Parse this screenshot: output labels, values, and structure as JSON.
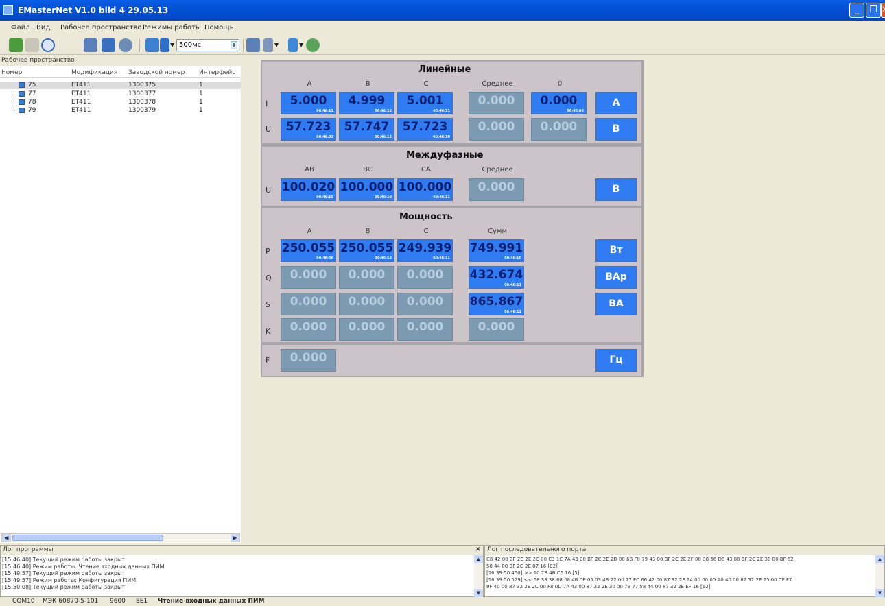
{
  "window": {
    "title": "EMasterNet  V1.0 bild 4 29.05.13"
  },
  "menu": [
    "Файл",
    "Вид",
    "Рабочее пространство",
    "Режимы работы",
    "Помощь"
  ],
  "toolbar": {
    "interval": "500мс"
  },
  "workspace": {
    "title": "Рабочее пространство",
    "columns": [
      "Номер",
      "Модификация",
      "Заводской номер",
      "Интерфейс"
    ],
    "rows": [
      {
        "num": "75",
        "mod": "ET411",
        "serial": "1300375",
        "iface": "1"
      },
      {
        "num": "77",
        "mod": "ET411",
        "serial": "1300377",
        "iface": "1"
      },
      {
        "num": "78",
        "mod": "ET411",
        "serial": "1300378",
        "iface": "1"
      },
      {
        "num": "79",
        "mod": "ET411",
        "serial": "1300379",
        "iface": "1"
      }
    ]
  },
  "linear": {
    "title": "Линейные",
    "cols": [
      "A",
      "B",
      "C",
      "Среднее",
      "0"
    ],
    "rows": [
      {
        "label": "I",
        "unit": "A",
        "cells": [
          {
            "v": "5.000",
            "ts": "00:46:11",
            "on": true
          },
          {
            "v": "4.999",
            "ts": "00:46:12",
            "on": true
          },
          {
            "v": "5.001",
            "ts": "00:46:11",
            "on": true
          },
          {
            "v": "0.000",
            "ts": "",
            "on": false
          },
          {
            "v": "0.000",
            "ts": "00:46:06",
            "on": true
          }
        ]
      },
      {
        "label": "U",
        "unit": "В",
        "cells": [
          {
            "v": "57.723",
            "ts": "00:46:02",
            "on": true
          },
          {
            "v": "57.747",
            "ts": "00:46:12",
            "on": true
          },
          {
            "v": "57.723",
            "ts": "00:46:10",
            "on": true
          },
          {
            "v": "0.000",
            "ts": "",
            "on": false
          },
          {
            "v": "0.000",
            "ts": "",
            "on": false
          }
        ]
      }
    ]
  },
  "interphase": {
    "title": "Междуфазные",
    "cols": [
      "AB",
      "BC",
      "CA",
      "Среднее"
    ],
    "rows": [
      {
        "label": "U",
        "unit": "В",
        "cells": [
          {
            "v": "100.020",
            "ts": "00:46:10",
            "on": true
          },
          {
            "v": "100.000",
            "ts": "00:46:10",
            "on": true
          },
          {
            "v": "100.000",
            "ts": "00:46:11",
            "on": true
          },
          {
            "v": "0.000",
            "ts": "",
            "on": false
          }
        ]
      }
    ]
  },
  "power": {
    "title": "Мощность",
    "cols": [
      "A",
      "B",
      "C",
      "Сумм"
    ],
    "rows": [
      {
        "label": "P",
        "unit": "Вт",
        "cells": [
          {
            "v": "250.055",
            "ts": "00:46:06",
            "on": true
          },
          {
            "v": "250.055",
            "ts": "00:46:12",
            "on": true
          },
          {
            "v": "249.939",
            "ts": "00:46:11",
            "on": true
          },
          {
            "v": "749.991",
            "ts": "00:46:10",
            "on": true
          }
        ]
      },
      {
        "label": "Q",
        "unit": "ВАр",
        "cells": [
          {
            "v": "0.000",
            "ts": "",
            "on": false
          },
          {
            "v": "0.000",
            "ts": "",
            "on": false
          },
          {
            "v": "0.000",
            "ts": "",
            "on": false
          },
          {
            "v": "432.674",
            "ts": "00:46:11",
            "on": true
          }
        ]
      },
      {
        "label": "S",
        "unit": "ВА",
        "cells": [
          {
            "v": "0.000",
            "ts": "",
            "on": false
          },
          {
            "v": "0.000",
            "ts": "",
            "on": false
          },
          {
            "v": "0.000",
            "ts": "",
            "on": false
          },
          {
            "v": "865.867",
            "ts": "00:46:11",
            "on": true
          }
        ]
      },
      {
        "label": "K",
        "unit": "",
        "cells": [
          {
            "v": "0.000",
            "ts": "",
            "on": false
          },
          {
            "v": "0.000",
            "ts": "",
            "on": false
          },
          {
            "v": "0.000",
            "ts": "",
            "on": false
          },
          {
            "v": "0.000",
            "ts": "",
            "on": false
          }
        ]
      }
    ]
  },
  "frequency": {
    "label": "F",
    "value": "0.000",
    "unit": "Гц"
  },
  "program_log": {
    "title": "Лог программы",
    "lines": [
      "[15:46:40]  Текущий режим работы закрыт",
      "[15:46:40]  Режим работы: Чтение входных данных ПИМ",
      "[15:49:57]  Текущий режим работы закрыт",
      "[15:49:57]  Режим работы: Конфигурация ПИМ",
      "[15:50:08]  Текущий режим работы закрыт"
    ]
  },
  "port_log": {
    "title": "Лог последовательного порта",
    "lines": [
      "C8 42 00 BF 2C 2E 2C 00 C3 1C 7A 43 00 BF 2C 2E 2D 00 6B F0 79 43 00 BF 2C 2E 2F 00 38 56 D8 43 00 BF 2C 2E 30 00 BF 82",
      "58 44 00 BF 2C 2E 87 16 [82]",
      "[16:39:50 450] >> 10 7B 4B C6 16 [5]",
      "[16:39:50 529] << 68 38 38 68 08 4B 0E 05 03 4B 22 00 77 FC 66 42 00 87 32 2E 24 00 00 00 A0 40 00 87 32 2E 25 00 CF F7",
      "9F 40 00 87 32 2E 2C 00 F8 0D 7A 43 00 87 32 2E 30 00 79 77 58 44 00 87 32 2E EF 16 [62]"
    ]
  },
  "status": [
    "COM10",
    "МЭК 60870-5-101",
    "9600",
    "8E1",
    "Чтение входных данных ПИМ"
  ]
}
